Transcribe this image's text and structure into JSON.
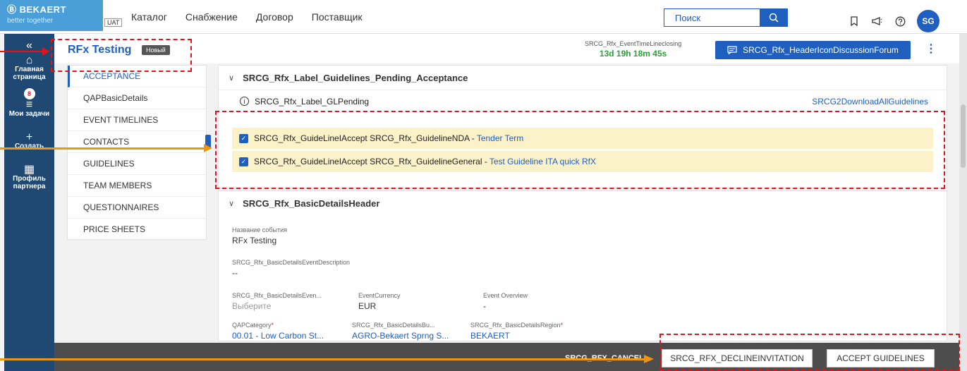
{
  "header": {
    "brand": "Ⓑ BEKAERT",
    "tagline": "better together",
    "env": "UAT",
    "nav": [
      "Каталог",
      "Снабжение",
      "Договор",
      "Поставщик"
    ],
    "search_placeholder": "Поиск",
    "avatar": "SG"
  },
  "rail": {
    "collapse": "«",
    "items": [
      {
        "label": "Главная страница",
        "icon": "home-icon"
      },
      {
        "label": "Мои задачи",
        "badge": "8",
        "icon": "list-icon"
      },
      {
        "label": "Создать",
        "icon": "plus-icon"
      },
      {
        "label": "Профиль партнера",
        "icon": "org-icon"
      }
    ]
  },
  "titlebar": {
    "title": "RFx Testing",
    "status": "Новый",
    "timer_label": "SRCG_Rfx_EventTimeLineclosing",
    "timer_value": "13d 19h 18m 45s",
    "forum_button": "SRCG_Rfx_HeaderIconDiscussionForum"
  },
  "section_nav": [
    "ACCEPTANCE",
    "QAPBasicDetails",
    "EVENT TIMELINES",
    "CONTACTS",
    "GUIDELINES",
    "TEAM MEMBERS",
    "QUESTIONNAIRES",
    "PRICE SHEETS"
  ],
  "guidelines_panel": {
    "title": "SRCG_Rfx_Label_Guidelines_Pending_Acceptance",
    "pending_label": "SRCG_Rfx_Label_GLPending",
    "download_link": "SRCG2DownloadAllGuidelines",
    "items": [
      {
        "text": "SRCG_Rfx_GuideLineIAccept SRCG_Rfx_GuidelineNDA -",
        "link": "Tender Term",
        "checked": true
      },
      {
        "text": "SRCG_Rfx_GuideLineIAccept SRCG_Rfx_GuidelineGeneral -",
        "link": "Test Guideline ITA quick RfX",
        "checked": true
      }
    ]
  },
  "basic_details": {
    "title": "SRCG_Rfx_BasicDetailsHeader",
    "event_name_label": "Название события",
    "event_name": "RFx Testing",
    "desc_label": "SRCG_Rfx_BasicDetailsEventDescription",
    "desc_value": "--",
    "evtype_label": "SRCG_Rfx_BasicDetailsEven...",
    "evtype_value": "Выберите",
    "currency_label": "EventCurrency",
    "currency_value": "EUR",
    "overview_label": "Event Overview",
    "overview_value": "-",
    "qap_label": "QAPCategory",
    "qap_value": "00.01 - Low Carbon St...",
    "bu_label": "SRCG_Rfx_BasicDetailsBu...",
    "bu_value": "AGRO-Bekaert Sprng S...",
    "region_label": "SRCG_Rfx_BasicDetailsRegion",
    "region_value": "BEKAERT",
    "required_mark": "*"
  },
  "actions": {
    "cancel": "SRCG_RFX_CANCEL",
    "decline": "SRCG_RFX_DECLINEINVITATION",
    "accept": "ACCEPT GUIDELINES"
  },
  "colors": {
    "primary": "#1e5fbf",
    "rail": "#1f4872",
    "annotation_red": "#e1141e",
    "annotation_orange": "#f0960e",
    "highlight": "#fcf2c9"
  }
}
